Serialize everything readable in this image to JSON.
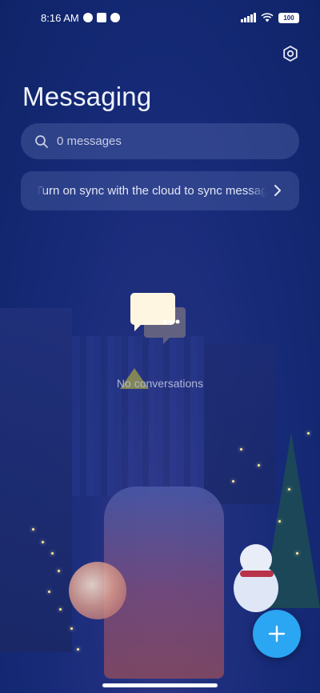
{
  "status_bar": {
    "time": "8:16 AM",
    "battery": "100",
    "icons": [
      "app-notification-icon",
      "square-notification-icon",
      "app-notification-icon",
      "signal-icon",
      "wifi-icon",
      "battery-icon"
    ]
  },
  "header": {
    "title": "Messaging",
    "settings_icon": "settings-icon"
  },
  "search": {
    "placeholder": "0 messages",
    "value": "",
    "icon": "search-icon"
  },
  "sync_banner": {
    "text": "Turn on sync with the cloud to sync messages",
    "icon": "chevron-right-icon"
  },
  "empty_state": {
    "label": "No conversations",
    "icon": "chat-bubbles-icon"
  },
  "fab": {
    "icon": "plus-icon",
    "color": "#2aa6f2"
  },
  "colors": {
    "background": "#162a78",
    "accent": "#2aa6f2"
  }
}
